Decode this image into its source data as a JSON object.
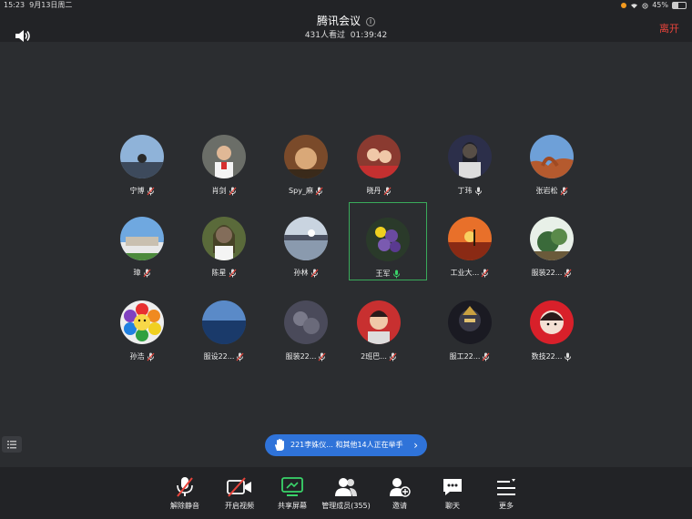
{
  "status": {
    "time": "15:23",
    "date": "9月13日周二",
    "battery": "45%",
    "battery_level": 0.45
  },
  "header": {
    "title": "腾讯会议",
    "viewers": "431人看过",
    "duration": "01:39:42",
    "leave_label": "离开"
  },
  "colors": {
    "accent": "#2f73d9",
    "danger": "#e8443b",
    "active_border": "#3aaa5a",
    "background": "#2b2d30"
  },
  "participants": [
    {
      "name": "宁博",
      "mic": "muted"
    },
    {
      "name": "肖剑",
      "mic": "muted"
    },
    {
      "name": "Spy_麻",
      "mic": "muted"
    },
    {
      "name": "晓丹",
      "mic": "muted"
    },
    {
      "name": "丁玮",
      "mic": "on"
    },
    {
      "name": "张岩松",
      "mic": "muted"
    },
    {
      "name": "璋",
      "mic": "muted"
    },
    {
      "name": "陈星",
      "mic": "muted"
    },
    {
      "name": "孙林",
      "mic": "muted"
    },
    {
      "name": "王军",
      "mic": "speaking",
      "active": true
    },
    {
      "name": "工业大...",
      "mic": "muted"
    },
    {
      "name": "服装22...",
      "mic": "muted"
    },
    {
      "name": "孙浩",
      "mic": "muted"
    },
    {
      "name": "服设22...",
      "mic": "muted"
    },
    {
      "name": "服装22...",
      "mic": "muted"
    },
    {
      "name": "2班巴...",
      "mic": "muted"
    },
    {
      "name": "服工22...",
      "mic": "muted"
    },
    {
      "name": "数技22...",
      "mic": "on"
    }
  ],
  "raise_hand": {
    "text": "221李姝仪... 和其他14人正在举手"
  },
  "toolbar": [
    {
      "label": "解除静音",
      "icon": "mic-muted-icon"
    },
    {
      "label": "开启视频",
      "icon": "video-off-icon"
    },
    {
      "label": "共享屏幕",
      "icon": "share-screen-icon"
    },
    {
      "label": "管理成员(355)",
      "icon": "members-icon"
    },
    {
      "label": "邀请",
      "icon": "invite-icon"
    },
    {
      "label": "聊天",
      "icon": "chat-icon"
    },
    {
      "label": "更多",
      "icon": "more-icon"
    }
  ]
}
